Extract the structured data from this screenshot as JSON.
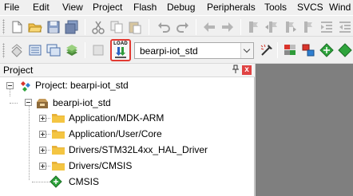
{
  "menu": [
    "File",
    "Edit",
    "View",
    "Project",
    "Flash",
    "Debug",
    "Peripherals",
    "Tools",
    "SVCS",
    "Wind"
  ],
  "toolbar": {
    "load_label": "LOAD",
    "target_value": "bearpi-iot_std"
  },
  "project_panel": {
    "title": "Project",
    "pin": "ᵖ",
    "close": "x",
    "root_label": "Project: bearpi-iot_std",
    "target_label": "bearpi-iot_std",
    "groups": [
      "Application/MDK-ARM",
      "Application/User/Core",
      "Drivers/STM32L4xx_HAL_Driver",
      "Drivers/CMSIS"
    ],
    "component_label": "CMSIS"
  },
  "colors": {
    "accent_red": "#e23a32",
    "folder_yellow": "#f4c542",
    "editor_background": "#7f7f7f"
  }
}
